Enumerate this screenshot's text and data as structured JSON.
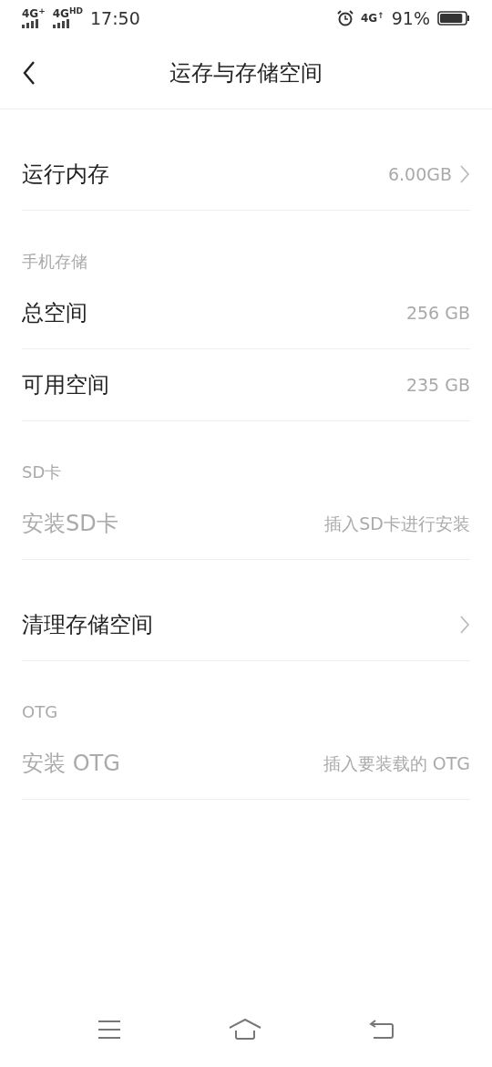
{
  "status_bar": {
    "signals": [
      "4G$^{+}$",
      "4G$^{HD}$"
    ],
    "time": "17:50",
    "network": "4G$^{↑}$",
    "battery": "91%"
  },
  "header": {
    "title": "运存与存储空间"
  },
  "sections": [
    {
      "rows": [
        {
          "label": "运行内存",
          "value": "6.00GB",
          "chevron": true,
          "disabled": false
        }
      ]
    },
    {
      "heading": "手机存储",
      "rows": [
        {
          "label": "总空间",
          "value": "256 GB",
          "chevron": false,
          "disabled": false
        },
        {
          "label": "可用空间",
          "value": "235 GB",
          "chevron": false,
          "disabled": false
        }
      ]
    },
    {
      "heading": "SD卡",
      "rows": [
        {
          "label": "安装SD卡",
          "value": "插入SD卡进行安装",
          "chevron": false,
          "disabled": true
        }
      ]
    },
    {
      "rows": [
        {
          "label": "清理存储空间",
          "chevron": true,
          "disabled": false
        }
      ]
    },
    {
      "heading": "OTG",
      "rows": [
        {
          "label": "安装 OTG",
          "value": "插入要装载的 OTG",
          "chevron": false,
          "disabled": true
        }
      ]
    }
  ]
}
